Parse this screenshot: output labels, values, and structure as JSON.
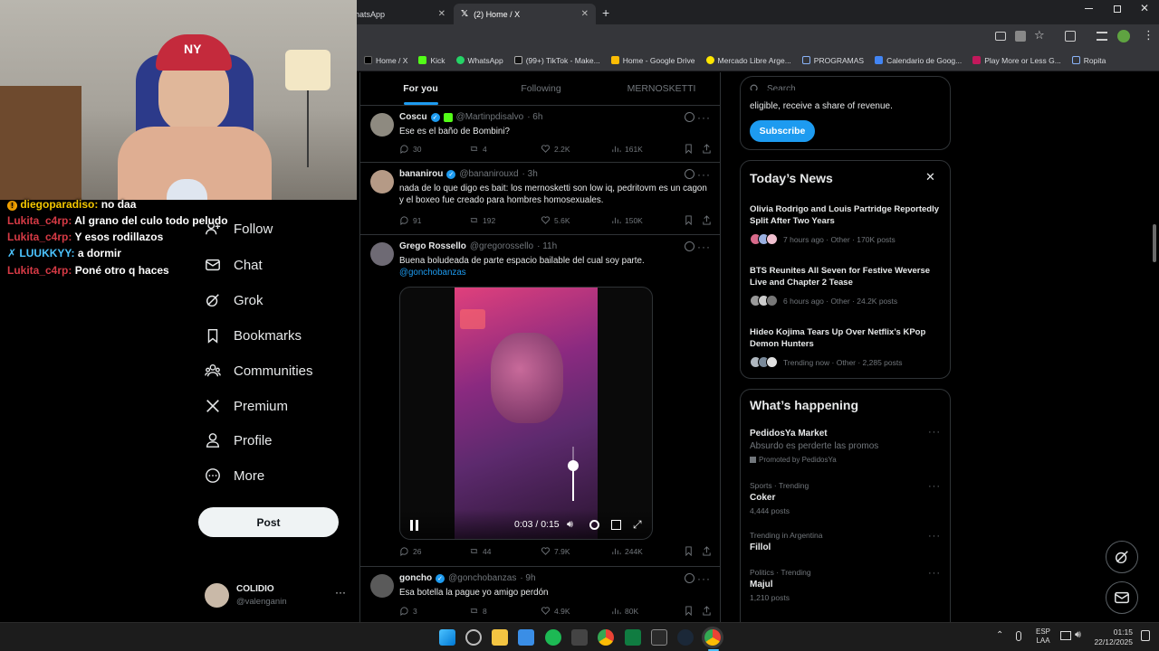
{
  "browser": {
    "tabs": [
      {
        "label": "hatsApp",
        "close": "✕"
      },
      {
        "label": "(2) Home / X",
        "close": "✕"
      }
    ],
    "new_tab": "+",
    "bookmarks": [
      {
        "label": "Home / X",
        "color": "#000000"
      },
      {
        "label": "Kick",
        "color": "#53fc18"
      },
      {
        "label": "WhatsApp",
        "color": "#25d366"
      },
      {
        "label": "(99+) TikTok - Make...",
        "color": "#111111"
      },
      {
        "label": "Home - Google Drive",
        "color": "#fbbc04"
      },
      {
        "label": "Mercado Libre Arge...",
        "color": "#ffe600"
      },
      {
        "label": "PROGRAMAS",
        "color": "#8ab4f8"
      },
      {
        "label": "Calendario de Goog...",
        "color": "#4285f4"
      },
      {
        "label": "Play More or Less G...",
        "color": "#c2185b"
      },
      {
        "label": "Ropita",
        "color": "#8ab4f8"
      }
    ]
  },
  "nav": {
    "items": [
      {
        "label": "Follow",
        "icon": "follow-icon"
      },
      {
        "label": "Chat",
        "icon": "mail-icon"
      },
      {
        "label": "Grok",
        "icon": "grok-icon"
      },
      {
        "label": "Bookmarks",
        "icon": "bookmark-icon"
      },
      {
        "label": "Communities",
        "icon": "communities-icon"
      },
      {
        "label": "Premium",
        "icon": "x-logo-icon"
      },
      {
        "label": "Profile",
        "icon": "profile-icon"
      },
      {
        "label": "More",
        "icon": "more-circle-icon"
      }
    ],
    "post_label": "Post",
    "profile": {
      "name": "COLIDIO",
      "handle": "@valenganin",
      "more": "···"
    }
  },
  "timeline": {
    "tabs": [
      "For you",
      "Following",
      "MERNOSKETTI"
    ],
    "tweets": [
      {
        "name": "Coscu",
        "handle": "@Martinpdisalvo",
        "time": "· 6h",
        "text": "Ese es el baño de Bombini?",
        "replies": "30",
        "reposts": "4",
        "likes": "2.2K",
        "views": "161K"
      },
      {
        "name": "bananirou",
        "handle": "@bananirouxd",
        "time": "· 3h",
        "text": "nada de lo que digo es bait: los mernosketti son low iq, pedritovm es un cagon y el boxeo fue creado para hombres homosexuales.",
        "replies": "91",
        "reposts": "192",
        "likes": "5.6K",
        "views": "150K"
      },
      {
        "name": "Grego Rossello",
        "handle": "@gregorossello",
        "time": "· 11h",
        "text": "Buena boludeada de parte espacio bailable del cual soy parte.",
        "mention": "@gonchobanzas",
        "video_time": "0:03 / 0:15",
        "video_progress": 0.2,
        "volume_level": 0.65,
        "replies": "26",
        "reposts": "44",
        "likes": "7.9K",
        "views": "244K"
      },
      {
        "name": "goncho",
        "handle": "@gonchobanzas",
        "time": "· 9h",
        "text": "Esa botella la pague yo amigo perdón",
        "replies": "3",
        "reposts": "8",
        "likes": "4.9K",
        "views": "80K"
      }
    ]
  },
  "sidebar": {
    "search_placeholder": "Search",
    "premium_text": "eligible, receive a share of revenue.",
    "subscribe_label": "Subscribe",
    "news_title": "Today’s News",
    "news_close": "✕",
    "news": [
      {
        "title": "Olivia Rodrigo and Louis Partridge Reportedly Split After Two Years",
        "meta": "7 hours ago · Other · 170K posts"
      },
      {
        "title": "BTS Reunites All Seven for Festive Weverse Live and Chapter 2 Tease",
        "meta": "6 hours ago · Other · 24.2K posts"
      },
      {
        "title": "Hideo Kojima Tears Up Over Netflix’s KPop Demon Hunters",
        "meta": "Trending now · Other · 2,285 posts"
      }
    ],
    "happening_title": "What’s happening",
    "promo": {
      "name": "PedidosYa Market",
      "desc": "Absurdo es perderte las promos",
      "promoted": "Promoted by PedidosYa"
    },
    "trends": [
      {
        "cat": "Sports · Trending",
        "name": "Coker",
        "posts": "4,444 posts"
      },
      {
        "cat": "Trending in Argentina",
        "name": "Fillol",
        "posts": ""
      },
      {
        "cat": "Politics · Trending",
        "name": "Majul",
        "posts": "1,210 posts"
      }
    ]
  },
  "stream_chat": [
    {
      "user": "diegoparadiso:",
      "msg": "no daa",
      "badge": "!"
    },
    {
      "user": "Lukita_c4rp:",
      "msg": "Al grano del culo todo peludo"
    },
    {
      "user": "Lukita_c4rp:",
      "msg": "Y esos rodillazos"
    },
    {
      "user": "LUUKKYY:",
      "msg": "a dormir",
      "badge": "✗"
    },
    {
      "user": "Lukita_c4rp:",
      "msg": "Poné otro q haces"
    }
  ],
  "taskbar": {
    "lang_top": "ESP",
    "lang_bottom": "LAA",
    "time": "01:15",
    "date": "22/12/2025"
  },
  "colors": {
    "accent": "#1d9bf0",
    "chat_red": "#d63a45"
  }
}
